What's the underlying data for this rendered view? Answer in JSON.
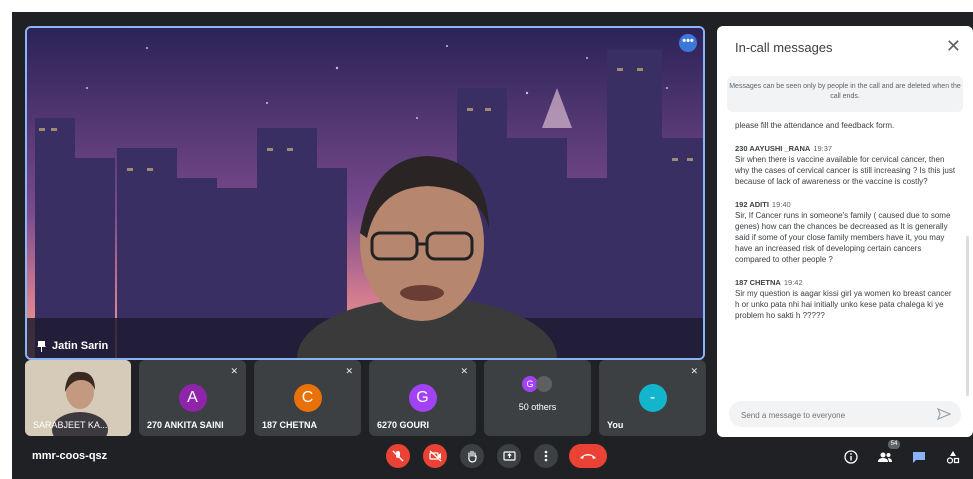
{
  "speaker": {
    "name": "Jatin Sarin"
  },
  "tiles": [
    {
      "name": "SARABJEET KA...",
      "initial": "",
      "color": ""
    },
    {
      "name": "270 ANKITA SAINI",
      "initial": "A",
      "color": "#8e24aa"
    },
    {
      "name": "187 CHETNA",
      "initial": "C",
      "color": "#e8710a"
    },
    {
      "name": "6270 GOURI",
      "initial": "G",
      "color": "#a142f4"
    },
    {
      "name": "50 others",
      "initial": "G",
      "color": "#a142f4"
    },
    {
      "name": "You",
      "initial": "-",
      "color": "#12b5cb"
    }
  ],
  "chat": {
    "title": "In-call messages",
    "notice": "Messages can be seen only by people in the call and are deleted when the call ends.",
    "first_text": "please fill the attendance and feedback form.",
    "messages": [
      {
        "sender": "230 AAYUSHI _RANA",
        "time": "19:37",
        "text": "Sir when there is vaccine available for cervical cancer, then why the cases of cervical cancer is still increasing ? Is this just because of lack of awareness or the vaccine is costly?"
      },
      {
        "sender": "192 ADITI",
        "time": "19:40",
        "text": "Sir, If Cancer runs in someone's family ( caused due to some genes) how can the chances be decreased as It is generally said if some of your close family members have it, you may have an increased risk of developing certain cancers compared to other people ?"
      },
      {
        "sender": "187 CHETNA",
        "time": "19:42",
        "text": "Sir my question is  aagar kissi girl ya women ko breast cancer h or unko pata nhi hai initially unko kese pata chalega ki ye problem ho sakti h ?????"
      }
    ],
    "input_placeholder": "Send a message to everyone"
  },
  "bottom": {
    "meeting_code": "mmr-coos-qsz",
    "participants_count": "54"
  },
  "icons": {
    "more": "more-horiz-icon",
    "pin": "pin-icon",
    "mic_off": "mic-off-icon",
    "cam_off": "videocam-off-icon",
    "hand": "raise-hand-icon",
    "present": "present-icon",
    "options": "more-vert-icon",
    "end": "call-end-icon",
    "info": "info-icon",
    "people": "people-icon",
    "chat": "chat-icon",
    "activities": "activities-icon",
    "close": "close-icon",
    "send": "send-icon"
  }
}
